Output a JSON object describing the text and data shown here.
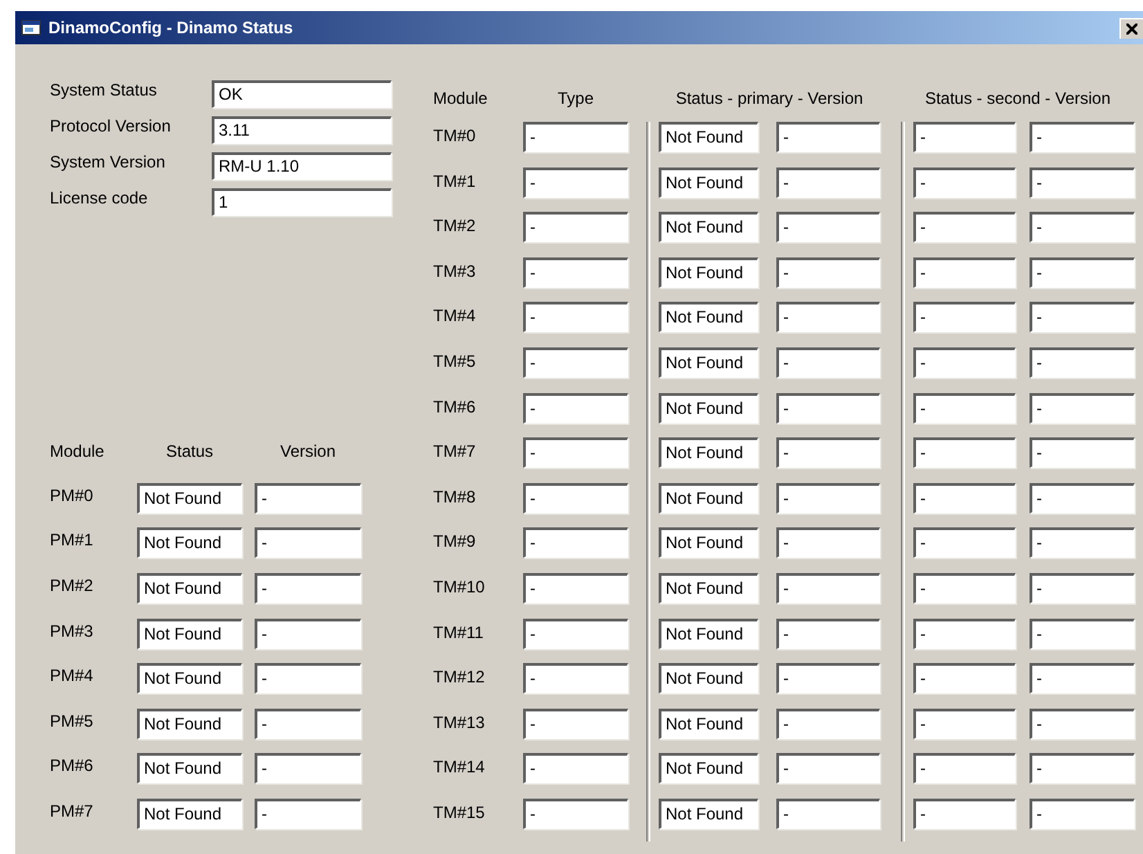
{
  "window": {
    "title": "DinamoConfig - Dinamo Status"
  },
  "system": [
    {
      "label": "System Status",
      "value": "OK"
    },
    {
      "label": "Protocol Version",
      "value": "3.11"
    },
    {
      "label": "System Version",
      "value": "RM-U 1.10"
    },
    {
      "label": "License code",
      "value": "1"
    }
  ],
  "pm_table": {
    "headers": [
      "Module",
      "Status",
      "Version"
    ],
    "rows": [
      {
        "module": "PM#0",
        "status": "Not Found",
        "version": "-"
      },
      {
        "module": "PM#1",
        "status": "Not Found",
        "version": "-"
      },
      {
        "module": "PM#2",
        "status": "Not Found",
        "version": "-"
      },
      {
        "module": "PM#3",
        "status": "Not Found",
        "version": "-"
      },
      {
        "module": "PM#4",
        "status": "Not Found",
        "version": "-"
      },
      {
        "module": "PM#5",
        "status": "Not Found",
        "version": "-"
      },
      {
        "module": "PM#6",
        "status": "Not Found",
        "version": "-"
      },
      {
        "module": "PM#7",
        "status": "Not Found",
        "version": "-"
      }
    ]
  },
  "tm_table": {
    "headers": [
      "Module",
      "Type",
      "Status - primary - Version",
      "Status - second - Version"
    ],
    "rows": [
      {
        "module": "TM#0",
        "type": "-",
        "primary_status": "Not Found",
        "primary_version": "-",
        "second_status": "-",
        "second_version": "-"
      },
      {
        "module": "TM#1",
        "type": "-",
        "primary_status": "Not Found",
        "primary_version": "-",
        "second_status": "-",
        "second_version": "-"
      },
      {
        "module": "TM#2",
        "type": "-",
        "primary_status": "Not Found",
        "primary_version": "-",
        "second_status": "-",
        "second_version": "-"
      },
      {
        "module": "TM#3",
        "type": "-",
        "primary_status": "Not Found",
        "primary_version": "-",
        "second_status": "-",
        "second_version": "-"
      },
      {
        "module": "TM#4",
        "type": "-",
        "primary_status": "Not Found",
        "primary_version": "-",
        "second_status": "-",
        "second_version": "-"
      },
      {
        "module": "TM#5",
        "type": "-",
        "primary_status": "Not Found",
        "primary_version": "-",
        "second_status": "-",
        "second_version": "-"
      },
      {
        "module": "TM#6",
        "type": "-",
        "primary_status": "Not Found",
        "primary_version": "-",
        "second_status": "-",
        "second_version": "-"
      },
      {
        "module": "TM#7",
        "type": "-",
        "primary_status": "Not Found",
        "primary_version": "-",
        "second_status": "-",
        "second_version": "-"
      },
      {
        "module": "TM#8",
        "type": "-",
        "primary_status": "Not Found",
        "primary_version": "-",
        "second_status": "-",
        "second_version": "-"
      },
      {
        "module": "TM#9",
        "type": "-",
        "primary_status": "Not Found",
        "primary_version": "-",
        "second_status": "-",
        "second_version": "-"
      },
      {
        "module": "TM#10",
        "type": "-",
        "primary_status": "Not Found",
        "primary_version": "-",
        "second_status": "-",
        "second_version": "-"
      },
      {
        "module": "TM#11",
        "type": "-",
        "primary_status": "Not Found",
        "primary_version": "-",
        "second_status": "-",
        "second_version": "-"
      },
      {
        "module": "TM#12",
        "type": "-",
        "primary_status": "Not Found",
        "primary_version": "-",
        "second_status": "-",
        "second_version": "-"
      },
      {
        "module": "TM#13",
        "type": "-",
        "primary_status": "Not Found",
        "primary_version": "-",
        "second_status": "-",
        "second_version": "-"
      },
      {
        "module": "TM#14",
        "type": "-",
        "primary_status": "Not Found",
        "primary_version": "-",
        "second_status": "-",
        "second_version": "-"
      },
      {
        "module": "TM#15",
        "type": "-",
        "primary_status": "Not Found",
        "primary_version": "-",
        "second_status": "-",
        "second_version": "-"
      }
    ]
  }
}
